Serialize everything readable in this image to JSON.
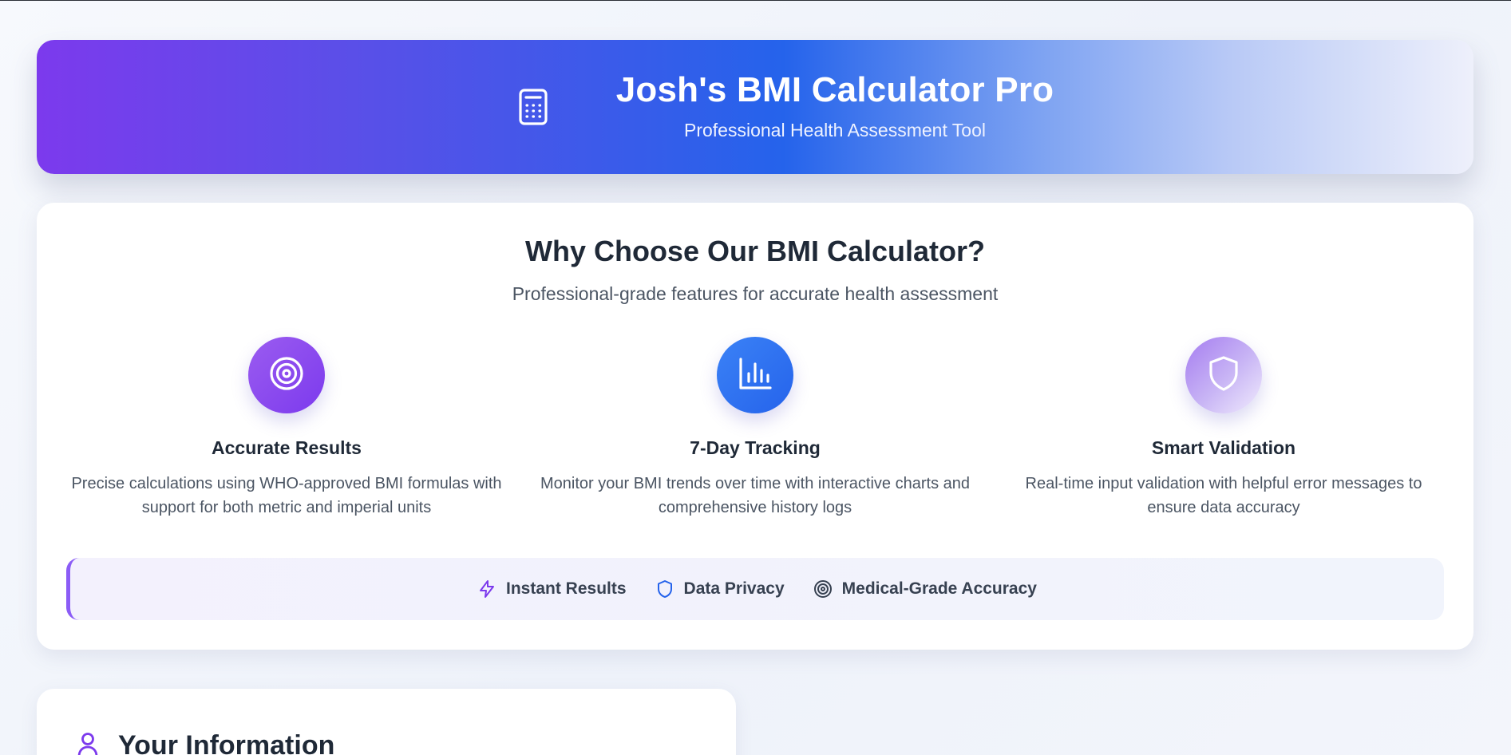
{
  "header": {
    "title": "Josh's BMI Calculator Pro",
    "subtitle": "Professional Health Assessment Tool",
    "icon": "calculator-icon"
  },
  "features": {
    "title": "Why Choose Our BMI Calculator?",
    "subtitle": "Professional-grade features for accurate health assessment",
    "items": [
      {
        "icon": "target-icon",
        "title": "Accurate Results",
        "description": "Precise calculations using WHO-approved BMI formulas with support for both metric and imperial units"
      },
      {
        "icon": "bar-chart-icon",
        "title": "7-Day Tracking",
        "description": "Monitor your BMI trends over time with interactive charts and comprehensive history logs"
      },
      {
        "icon": "shield-icon",
        "title": "Smart Validation",
        "description": "Real-time input validation with helpful error messages to ensure data accuracy"
      }
    ],
    "badges": [
      {
        "icon": "lightning-icon",
        "label": "Instant Results"
      },
      {
        "icon": "shield-icon",
        "label": "Data Privacy"
      },
      {
        "icon": "target-icon",
        "label": "Medical-Grade Accuracy"
      }
    ]
  },
  "info_section": {
    "icon": "user-icon",
    "title": "Your Information"
  },
  "colors": {
    "purple": "#7c3aed",
    "blue": "#2563eb",
    "text_dark": "#1f2937",
    "text_muted": "#4b5563"
  }
}
